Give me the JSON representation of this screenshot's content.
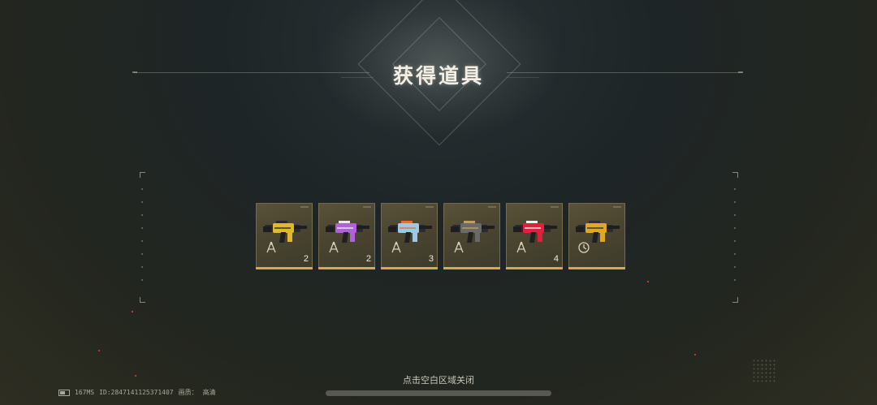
{
  "title": "获得道具",
  "hint": "点击空白区域关闭",
  "status": {
    "ping": "167MS",
    "id": "ID:2847141125371407",
    "quality_label": "画质：",
    "quality_value": "高清"
  },
  "items": [
    {
      "count": "2",
      "weapon_color": "#e0b82a",
      "accent": "#2a2a2a",
      "badge": "compass-badge-icon"
    },
    {
      "count": "2",
      "weapon_color": "#b060d8",
      "accent": "#e8e8f0",
      "badge": "compass-badge-icon"
    },
    {
      "count": "3",
      "weapon_color": "#9ec8e8",
      "accent": "#e07040",
      "badge": "compass-badge-icon"
    },
    {
      "count": "",
      "weapon_color": "#6a6a6a",
      "accent": "#c0a060",
      "badge": "compass-badge-icon"
    },
    {
      "count": "4",
      "weapon_color": "#e0203a",
      "accent": "#f0f0f0",
      "badge": "compass-badge-icon"
    },
    {
      "count": "",
      "weapon_color": "#e0a820",
      "accent": "#303030",
      "badge": "clock-badge-icon"
    }
  ]
}
